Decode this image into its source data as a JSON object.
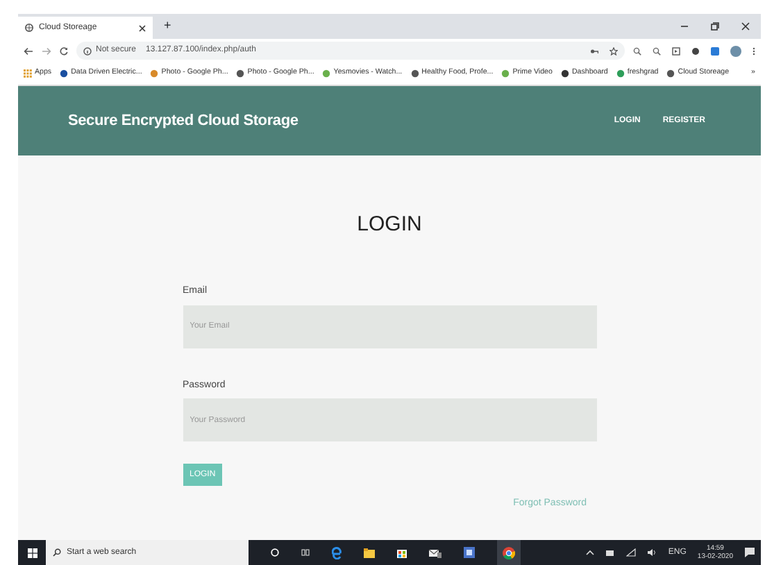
{
  "browser": {
    "tab_title": "Cloud Storeage",
    "new_tab": "+",
    "security": "Not secure",
    "url": "13.127.87.100/index.php/auth",
    "bookmarks": [
      "Apps",
      "Data Driven Electric...",
      "Photo - Google Ph...",
      "Photo - Google Ph...",
      "Yesmovies - Watch...",
      "Healthy Food, Profe...",
      "Prime Video",
      "Dashboard",
      "freshgrad",
      "Cloud Storeage"
    ],
    "more": "»"
  },
  "navbar": {
    "brand": "Secure Encrypted Cloud Storage",
    "links": [
      "LOGIN",
      "REGISTER"
    ]
  },
  "form": {
    "heading": "LOGIN",
    "fields": [
      {
        "label": "Email",
        "placeholder": "Your Email"
      },
      {
        "label": "Password",
        "placeholder": "Your Password"
      }
    ],
    "submit": "LOGIN",
    "forgot": "Forgot Password"
  },
  "taskbar": {
    "search_placeholder": "Start a web search",
    "language": "ENG",
    "time": "14:59",
    "date": "13-02-2020"
  }
}
